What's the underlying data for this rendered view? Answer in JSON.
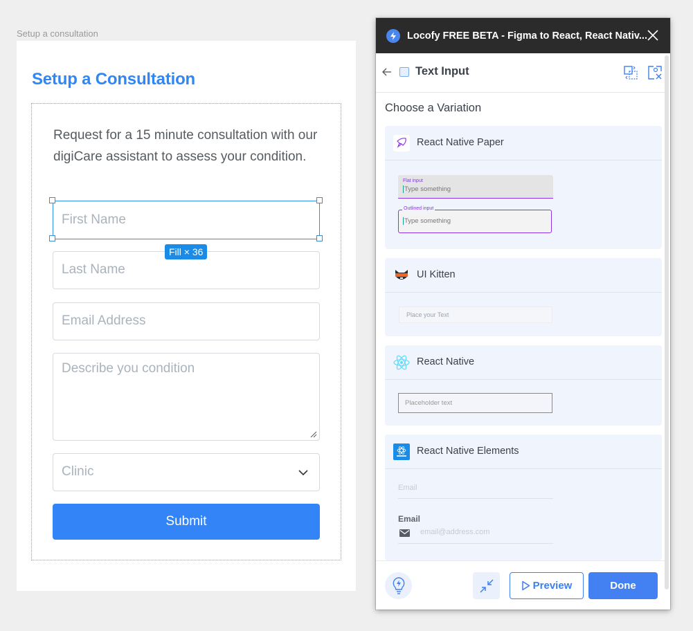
{
  "canvas": {
    "frame_label": "Setup a consultation",
    "selection_badge": "Fill × 36"
  },
  "form": {
    "title": "Setup a Consultation",
    "description": "Request for a 15 minute consultation with our digiCare assistant to assess your condition.",
    "fields": {
      "first_name_placeholder": "First Name",
      "last_name_placeholder": "Last Name",
      "email_placeholder": "Email Address",
      "condition_placeholder": "Describe you condition",
      "clinic_placeholder": "Clinic"
    },
    "submit_label": "Submit"
  },
  "plugin": {
    "window_title": "Locofy FREE BETA - Figma to React, React Nativ...",
    "nav_title": "Text Input",
    "section_title": "Choose a Variation",
    "variations": [
      {
        "name": "React Native Paper",
        "logo": "react-native-paper-logo",
        "preview": {
          "flat_label": "Flat input",
          "flat_placeholder": "Type something",
          "outlined_label": "Outlined input",
          "outlined_placeholder": "Type something"
        }
      },
      {
        "name": "UI Kitten",
        "logo": "ui-kitten-logo",
        "preview": {
          "placeholder": "Place your Text"
        }
      },
      {
        "name": "React Native",
        "logo": "react-atom-logo",
        "preview": {
          "placeholder": "Placeholder text"
        }
      },
      {
        "name": "React Native Elements",
        "logo": "react-native-elements-logo",
        "preview": {
          "plain_placeholder": "Email",
          "label": "Email",
          "icon_placeholder": "email@address.com"
        }
      }
    ],
    "footer": {
      "preview_label": "Preview",
      "done_label": "Done"
    },
    "colors": {
      "accent": "#4381f3",
      "paper_purple": "#8a35e8",
      "titlebar": "#2b2b2b"
    }
  }
}
